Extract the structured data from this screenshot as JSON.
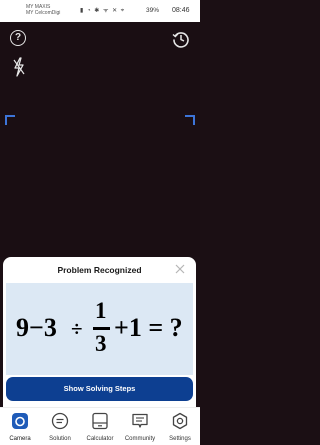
{
  "status_bar": {
    "carrier_1": "MY MAXIS",
    "carrier_2": "MY CelcomDigi",
    "battery": "39%",
    "time": "08:46"
  },
  "camera": {
    "help_glyph": "?",
    "icons": [
      "help-icon",
      "flash-off-icon",
      "history-icon"
    ],
    "accent_color": "#3d74d8"
  },
  "result_card": {
    "title": "Problem Recognized",
    "expression": {
      "lhs": "9−3",
      "operator": "÷",
      "numerator": "1",
      "denominator": "3",
      "rhs": "+1 = ?"
    },
    "button_label": "Show Solving Steps",
    "button_color": "#0d3f91"
  },
  "bottom_nav": {
    "items": [
      {
        "label": "Camera",
        "icon": "camera-icon",
        "active": true
      },
      {
        "label": "Solution",
        "icon": "solution-icon",
        "active": false
      },
      {
        "label": "Calculator",
        "icon": "calculator-icon",
        "active": false
      },
      {
        "label": "Community",
        "icon": "community-icon",
        "active": false
      },
      {
        "label": "Settings",
        "icon": "settings-icon",
        "active": false
      }
    ]
  }
}
